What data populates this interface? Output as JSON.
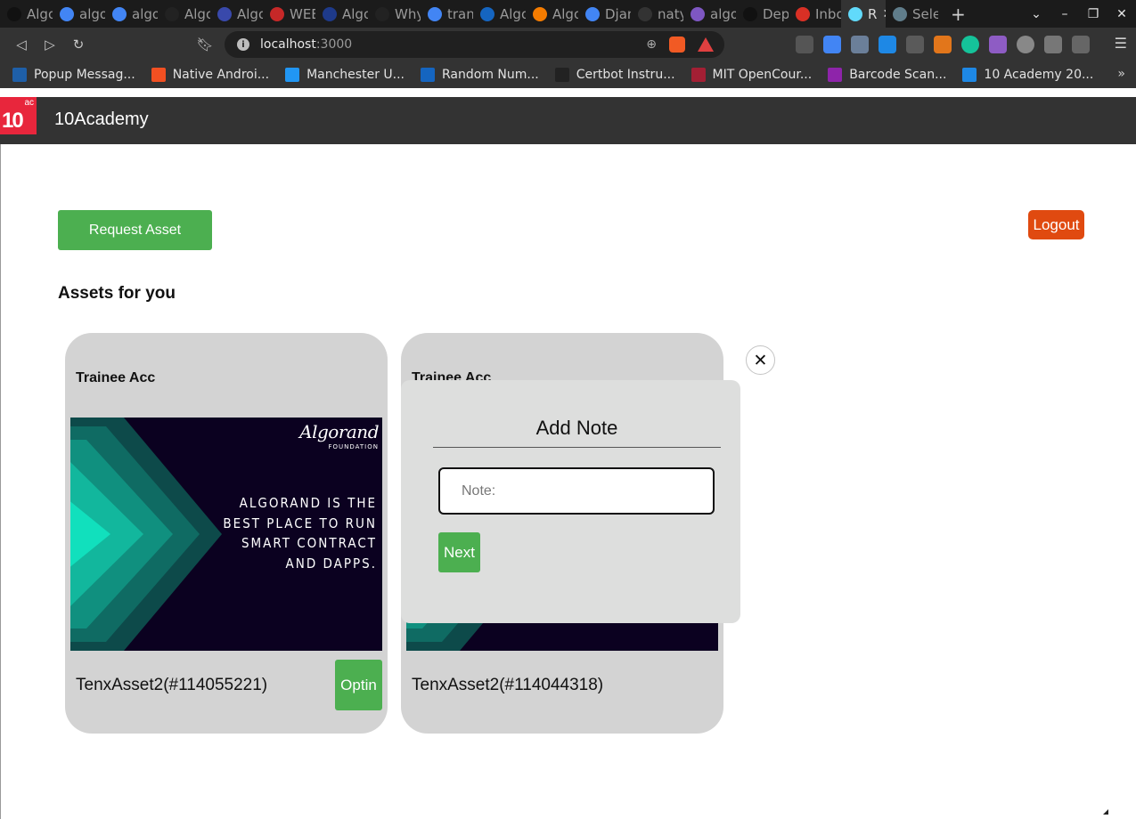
{
  "browser": {
    "tabs": [
      {
        "label": "Algo",
        "color": "#111111"
      },
      {
        "label": "algo",
        "color": "#4285f4"
      },
      {
        "label": "algo",
        "color": "#4285f4"
      },
      {
        "label": "Algo",
        "color": "#222222"
      },
      {
        "label": "Algo",
        "color": "#3949ab"
      },
      {
        "label": "WEB",
        "color": "#c62828"
      },
      {
        "label": "Algo",
        "color": "#1e3a8a"
      },
      {
        "label": "Why",
        "color": "#222222"
      },
      {
        "label": "tran",
        "color": "#4285f4"
      },
      {
        "label": "Algo",
        "color": "#1565c0"
      },
      {
        "label": "Algo",
        "color": "#f57c00"
      },
      {
        "label": "Djan",
        "color": "#4285f4"
      },
      {
        "label": "naty",
        "color": "#333333"
      },
      {
        "label": "algo",
        "color": "#7e57c2"
      },
      {
        "label": "Dep",
        "color": "#111111"
      },
      {
        "label": "Inbo",
        "color": "#d93025"
      },
      {
        "label": "R",
        "color": "#61dafb",
        "active": true
      },
      {
        "label": "Sele",
        "color": "#607d8b"
      }
    ],
    "url": {
      "host": "localhost",
      "port": ":3000"
    },
    "bookmarks": [
      {
        "label": "Popup Messag...",
        "color": "#1e5fa8"
      },
      {
        "label": "Native Androi...",
        "color": "#f25022"
      },
      {
        "label": "Manchester U...",
        "color": "#2196f3"
      },
      {
        "label": "Random Num...",
        "color": "#1565c0"
      },
      {
        "label": "Certbot Instru...",
        "color": "#222222"
      },
      {
        "label": "MIT OpenCour...",
        "color": "#a31f34"
      },
      {
        "label": "Barcode Scan...",
        "color": "#8e24aa"
      },
      {
        "label": "10 Academy 20...",
        "color": "#1e88e5"
      }
    ]
  },
  "app": {
    "logo_number": "10",
    "logo_sup": "ac",
    "brand": "10Academy",
    "request_button": "Request Asset",
    "logout_button": "Logout",
    "section_title": "Assets for you"
  },
  "cards": [
    {
      "title": "Trainee Acc",
      "asset_name": "TenxAsset2(#114055221)",
      "optin_label": "Optin",
      "image_logo": "Algorand",
      "image_logo_sub": "FOUNDATION",
      "image_lines": [
        "ALGORAND IS THE",
        "BEST PLACE TO RUN",
        "SMART CONTRACT",
        "AND DAPPS."
      ]
    },
    {
      "title": "Trainee Acc",
      "asset_name": "TenxAsset2(#114044318)"
    }
  ],
  "modal": {
    "title": "Add Note",
    "input_placeholder": "Note:",
    "next_button": "Next",
    "close_symbol": "✕"
  },
  "colors": {
    "accent_green": "#4caf50",
    "logout_orange": "#e04a10",
    "brand_red": "#e8263c"
  }
}
